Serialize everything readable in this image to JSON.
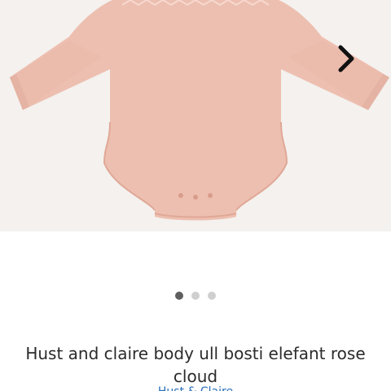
{
  "gallery": {
    "image_alt": "Pink wool long-sleeve baby body",
    "next_arrow_icon": "chevron-right-icon",
    "dots": [
      {
        "active": true
      },
      {
        "active": false
      },
      {
        "active": false
      }
    ]
  },
  "product": {
    "title": "Hust and claire body ull bosti elefant rose cloud",
    "brand": "Hust & Claire"
  },
  "colors": {
    "garment": "#edbfb0",
    "background": "#f4f1ee",
    "link": "#2a6ebb"
  }
}
